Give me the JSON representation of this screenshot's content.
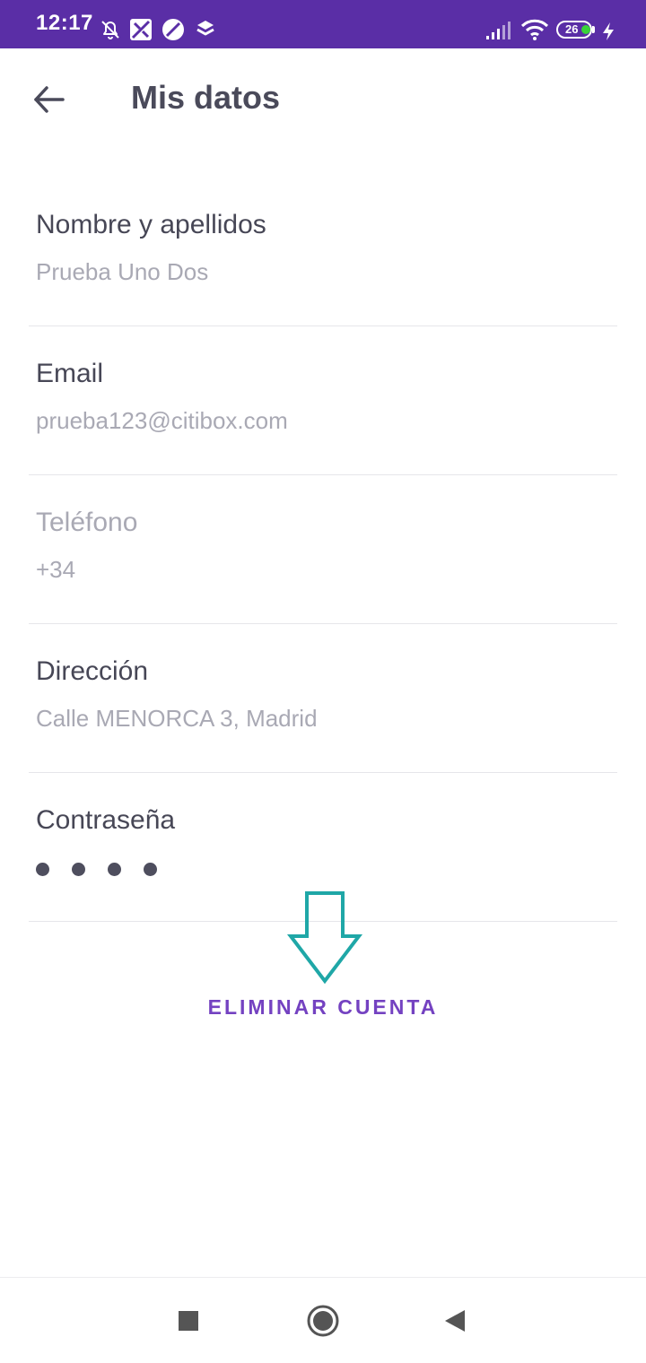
{
  "status_bar": {
    "time": "12:17",
    "icons": [
      "bell-off-icon",
      "maps-icon",
      "vpn-icon",
      "dropbox-icon",
      "signal-icon",
      "wifi-icon"
    ],
    "battery_level": "26",
    "background_color": "#5a2ea6"
  },
  "header": {
    "title": "Mis datos",
    "back_icon": "arrow-left-icon"
  },
  "fields": [
    {
      "label": "Nombre y apellidos",
      "value": "Prueba Uno Dos",
      "enabled": true
    },
    {
      "label": "Email",
      "value": "prueba123@citibox.com",
      "enabled": true
    },
    {
      "label": "Teléfono",
      "value": "+34",
      "enabled": false
    },
    {
      "label": "Dirección",
      "value": "Calle MENORCA 3, Madrid",
      "enabled": true
    },
    {
      "label": "Contraseña",
      "value_masked_dots": 4,
      "enabled": true
    }
  ],
  "annotation": {
    "icon": "down-arrow-outline-icon",
    "color": "#1fa7a7"
  },
  "actions": {
    "delete_account": "ELIMINAR CUENTA",
    "accent_color": "#7442c1"
  },
  "nav_bar": {
    "buttons": [
      "recents-square-icon",
      "home-circle-icon",
      "back-triangle-icon"
    ]
  }
}
